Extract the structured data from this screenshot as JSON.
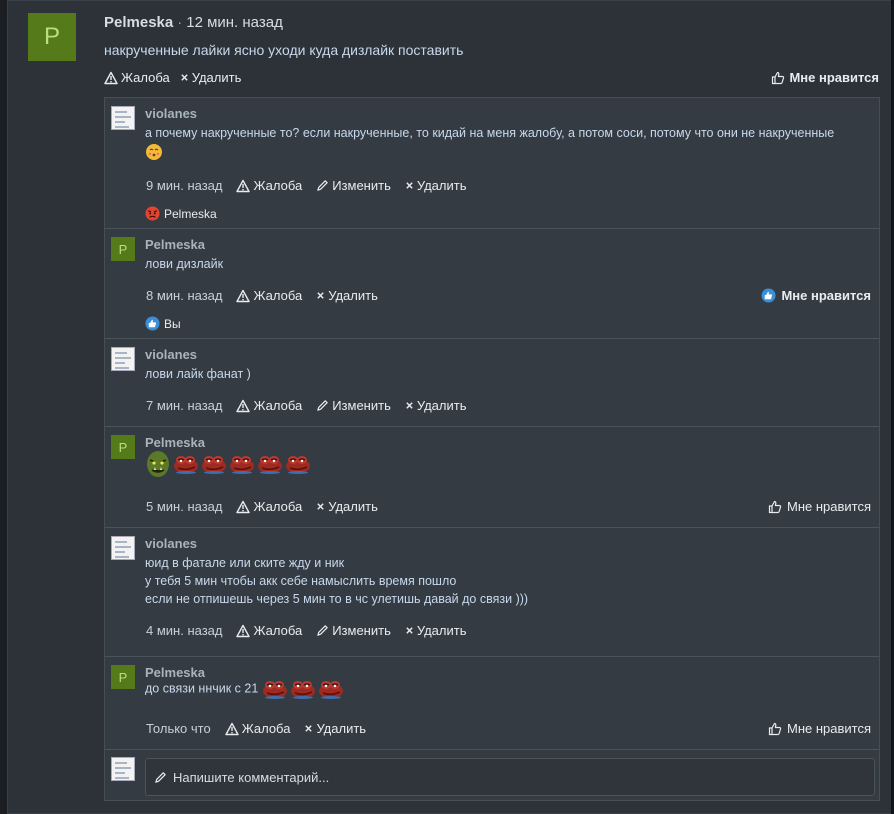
{
  "post": {
    "avatar_letter": "P",
    "author": "Pelmeska",
    "separator": "·",
    "time": "12 мин. назад",
    "text": "накрученные лайки ясно уходи куда дизлайк поставить",
    "report_label": "Жалоба",
    "delete_label": "Удалить",
    "like_label": "Мне нравится"
  },
  "comments": [
    {
      "author": "violanes",
      "text": "а почему накрученные то? если накрученные, то кидай на меня жалобу, а потом соси, потому что они не накрученные",
      "emoji": "kissing-face",
      "time": "9 мин. назад",
      "report_label": "Жалоба",
      "edit_label": "Изменить",
      "delete_label": "Удалить",
      "reaction_user": "Pelmeska",
      "reaction_icon": "angry-face"
    },
    {
      "avatar_letter": "P",
      "author": "Pelmeska",
      "text": "лови дизлайк",
      "time": "8 мин. назад",
      "report_label": "Жалоба",
      "delete_label": "Удалить",
      "like_label": "Мне нравится",
      "reaction_user": "Вы",
      "reaction_icon": "thumbs-up-badge"
    },
    {
      "author": "violanes",
      "text": "лови лайк фанат )",
      "time": "7 мин. назад",
      "report_label": "Жалоба",
      "edit_label": "Изменить",
      "delete_label": "Удалить"
    },
    {
      "avatar_letter": "P",
      "author": "Pelmeska",
      "emotes": [
        "orc-emote",
        "angry-frog-emote",
        "angry-frog-emote",
        "angry-frog-emote",
        "angry-frog-emote",
        "angry-frog-emote"
      ],
      "time": "5 мин. назад",
      "report_label": "Жалоба",
      "delete_label": "Удалить",
      "like_label": "Мне нравится"
    },
    {
      "author": "violanes",
      "lines": [
        "юид в фатале или ските жду и ник",
        "у тебя 5 мин чтобы акк себе намыслить время пошло",
        "если не отпишешь через 5 мин то в чс улетишь давай до связи )))"
      ],
      "time": "4 мин. назад",
      "report_label": "Жалоба",
      "edit_label": "Изменить",
      "delete_label": "Удалить"
    },
    {
      "avatar_letter": "P",
      "author": "Pelmeska",
      "text": "до связи ннчик с 21",
      "emotes": [
        "angry-frog-emote",
        "angry-frog-emote",
        "angry-frog-emote"
      ],
      "time": "Только что",
      "report_label": "Жалоба",
      "delete_label": "Удалить",
      "like_label": "Мне нравится"
    }
  ],
  "composer": {
    "placeholder": "Напишите комментарий..."
  },
  "colors": {
    "background": "#1f2428",
    "panel": "#2c3238",
    "comment_box": "#343b42",
    "avatar_green": "#557a1a",
    "text_blue": "#c8d8ec",
    "like_blue": "#3b8fd6"
  }
}
